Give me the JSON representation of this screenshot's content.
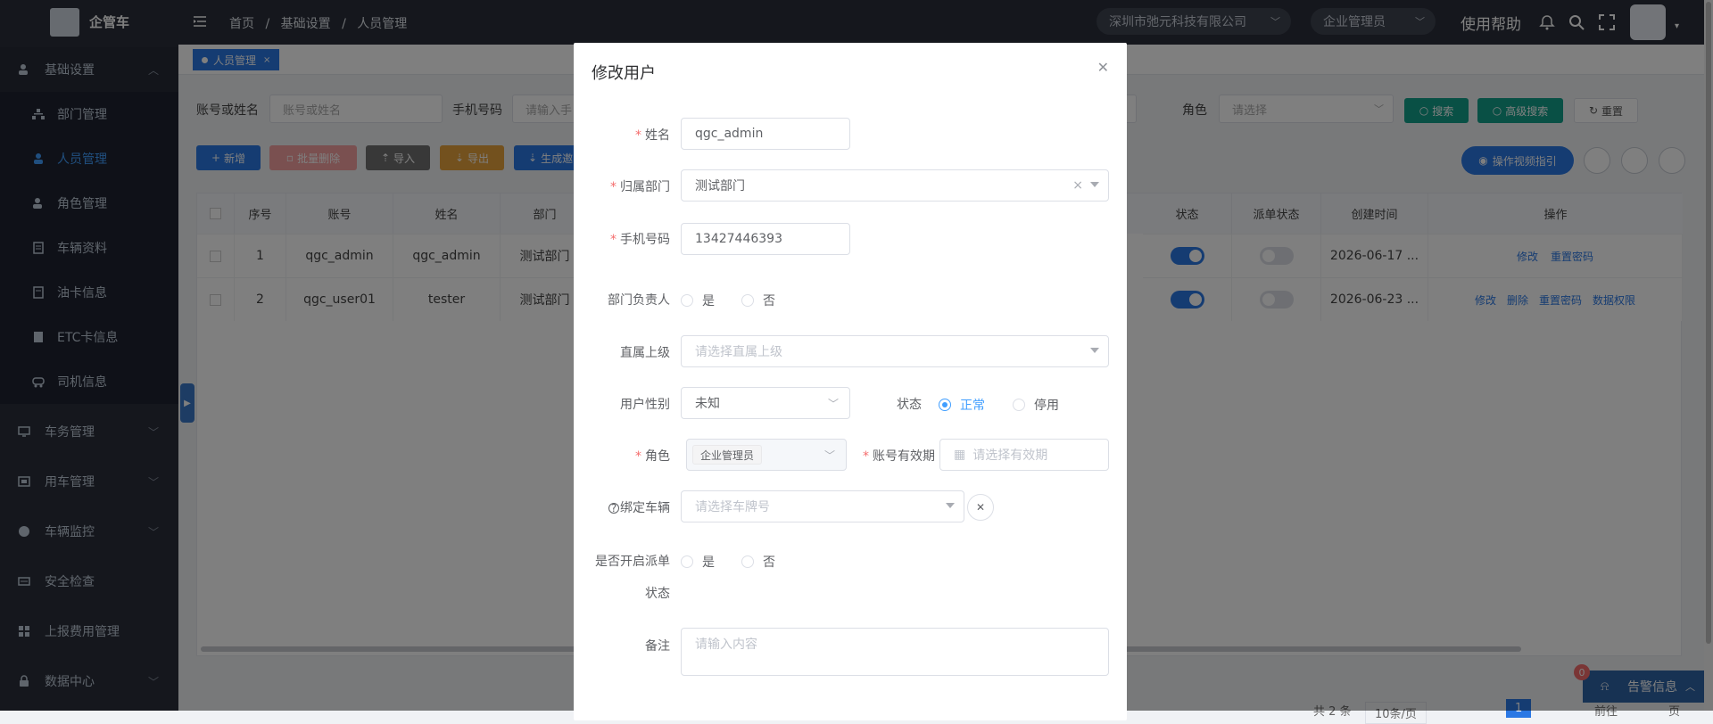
{
  "app": {
    "name": "企管车"
  },
  "sidebar": {
    "items": [
      {
        "label": "基础设置",
        "icon": "user-settings-icon",
        "expanded": true
      },
      {
        "label": "部门管理",
        "icon": "org-icon"
      },
      {
        "label": "人员管理",
        "icon": "user-icon",
        "active": true
      },
      {
        "label": "角色管理",
        "icon": "role-icon"
      },
      {
        "label": "车辆资料",
        "icon": "car-doc-icon"
      },
      {
        "label": "油卡信息",
        "icon": "fuel-card-icon"
      },
      {
        "label": "ETC卡信息",
        "icon": "etc-card-icon"
      },
      {
        "label": "司机信息",
        "icon": "driver-icon"
      },
      {
        "label": "车务管理",
        "icon": "monitor-icon"
      },
      {
        "label": "用车管理",
        "icon": "car-use-icon"
      },
      {
        "label": "车辆监控",
        "icon": "globe-icon"
      },
      {
        "label": "安全检查",
        "icon": "check-icon"
      },
      {
        "label": "上报费用管理",
        "icon": "grid-icon"
      },
      {
        "label": "数据中心",
        "icon": "lock-icon"
      }
    ]
  },
  "header": {
    "breadcrumb": [
      "首页",
      "基础设置",
      "人员管理"
    ],
    "company": "深圳市弛元科技有限公司",
    "role": "企业管理员",
    "help": "使用帮助"
  },
  "tags": {
    "current": "人员管理"
  },
  "filters": {
    "account_label": "账号或姓名",
    "account_placeholder": "账号或姓名",
    "phone_label": "手机号码",
    "phone_placeholder": "请输入手",
    "role_label": "角色",
    "role_placeholder": "请选择",
    "search": "搜索",
    "advanced": "高级搜索",
    "reset": "重置"
  },
  "toolbar": {
    "add": "新增",
    "batch_delete": "批量删除",
    "import": "导入",
    "export": "导出",
    "generate": "生成邀",
    "guide": "操作视频指引"
  },
  "table": {
    "columns": [
      "序号",
      "账号",
      "姓名",
      "部门",
      "状态",
      "派单状态",
      "创建时间",
      "操作"
    ],
    "rows": [
      {
        "idx": "1",
        "account": "qgc_admin",
        "name": "qgc_admin",
        "dept": "测试部门",
        "status": true,
        "dispatch": false,
        "created": "2026-06-17 ...",
        "actions": [
          "修改",
          "重置密码"
        ]
      },
      {
        "idx": "2",
        "account": "qgc_user01",
        "name": "tester",
        "dept": "测试部门",
        "status": true,
        "dispatch": false,
        "created": "2026-06-23 ...",
        "actions": [
          "修改",
          "删除",
          "重置密码",
          "数据权限"
        ]
      }
    ]
  },
  "pagination": {
    "total": "共 2 条",
    "page_size": "10条/页",
    "current": "1",
    "goto": "前往",
    "page": "页"
  },
  "alarm": {
    "label": "告警信息",
    "count": "0"
  },
  "dialog": {
    "title": "修改用户",
    "fields": {
      "name_label": "姓名",
      "name_value": "qgc_admin",
      "dept_label": "归属部门",
      "dept_value": "测试部门",
      "phone_label": "手机号码",
      "phone_value": "13427446393",
      "leader_label": "部门负责人",
      "yes": "是",
      "no": "否",
      "superior_label": "直属上级",
      "superior_placeholder": "请选择直属上级",
      "gender_label": "用户性别",
      "gender_value": "未知",
      "status_label": "状态",
      "status_normal": "正常",
      "status_disabled": "停用",
      "role_label": "角色",
      "role_tag": "企业管理员",
      "expiry_label": "账号有效期",
      "expiry_placeholder": "请选择有效期",
      "vehicle_label": "绑定车辆",
      "vehicle_placeholder": "请选择车牌号",
      "dispatch_label_1": "是否开启派单",
      "dispatch_label_2": "状态",
      "remark_label": "备注",
      "remark_placeholder": "请输入内容"
    }
  }
}
